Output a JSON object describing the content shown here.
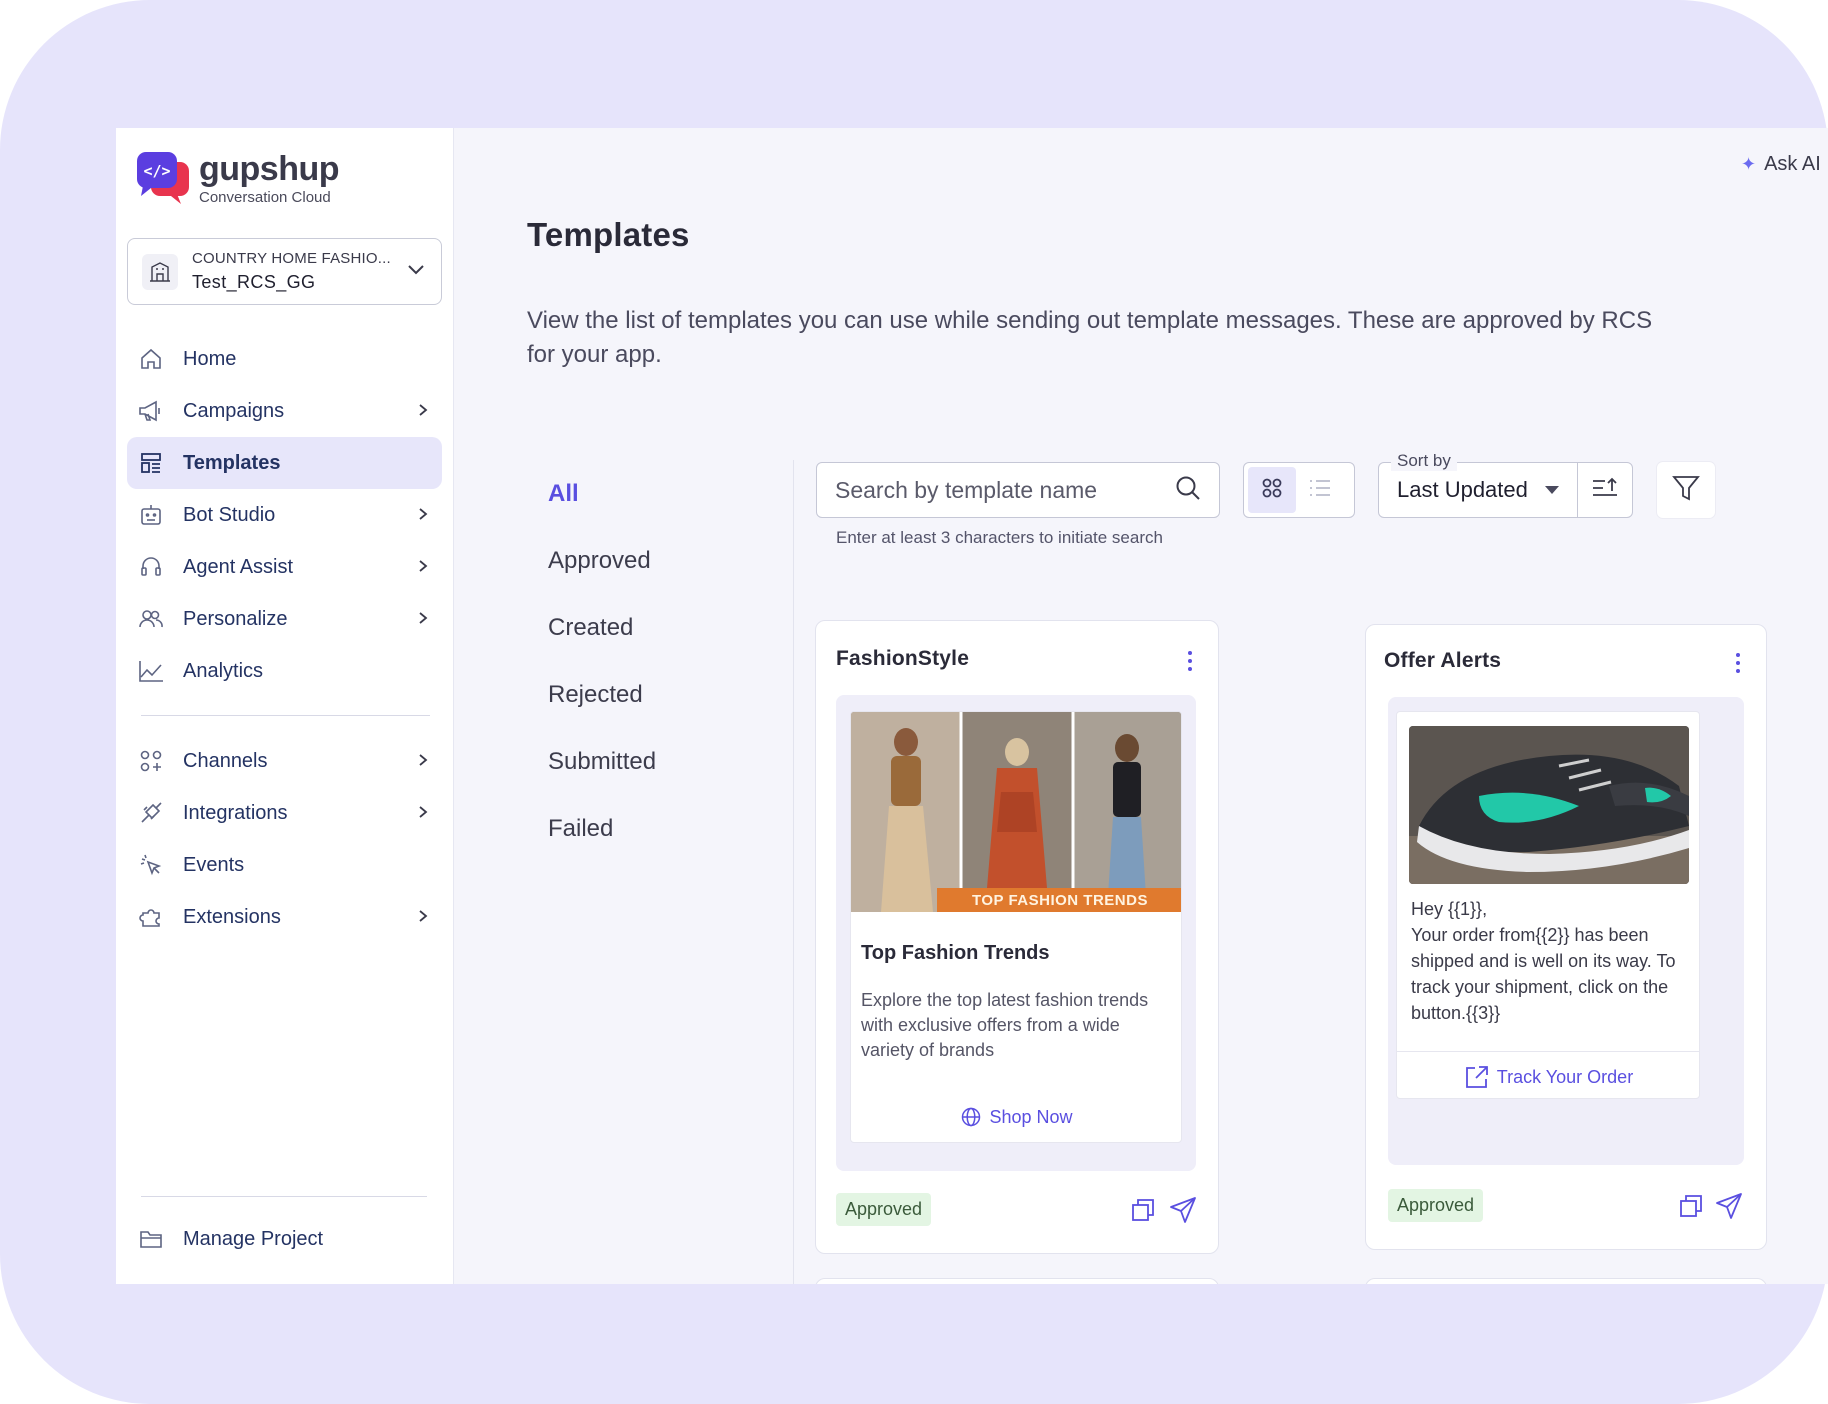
{
  "brand": {
    "name": "gupshup",
    "tagline": "Conversation Cloud"
  },
  "project": {
    "org": "COUNTRY HOME FASHIO...",
    "name": "Test_RCS_GG"
  },
  "nav": {
    "home": "Home",
    "campaigns": "Campaigns",
    "templates": "Templates",
    "bot_studio": "Bot Studio",
    "agent_assist": "Agent Assist",
    "personalize": "Personalize",
    "analytics": "Analytics",
    "channels": "Channels",
    "integrations": "Integrations",
    "events": "Events",
    "extensions": "Extensions",
    "manage_project": "Manage Project"
  },
  "header": {
    "ask_ai": "Ask AI"
  },
  "page": {
    "title": "Templates",
    "description": "View the list of templates you can use while sending out template messages. These are approved by RCS for your app."
  },
  "filters": [
    "All",
    "Approved",
    "Created",
    "Rejected",
    "Submitted",
    "Failed"
  ],
  "search": {
    "placeholder": "Search by template name",
    "hint": "Enter at least 3 characters to initiate search"
  },
  "sort": {
    "label": "Sort by",
    "value": "Last Updated"
  },
  "cards": [
    {
      "title": "FashionStyle",
      "image_caption": "TOP FASHION TRENDS",
      "rich_title": "Top Fashion Trends",
      "rich_desc": "Explore the top latest fashion trends with exclusive offers from a wide variety of brands",
      "button": "Shop Now",
      "status": "Approved"
    },
    {
      "title": "Offer Alerts",
      "message": "Hey {{1}},\nYour order from{{2}} has been shipped and is well on its way. To track your shipment,  click on the button.{{3}}",
      "button": "Track Your Order",
      "status": "Approved"
    }
  ],
  "colors": {
    "accent": "#5a4fe0",
    "nav_text": "#243363",
    "approved_bg": "#e3f5e3",
    "backdrop": "#e6e4fb"
  }
}
